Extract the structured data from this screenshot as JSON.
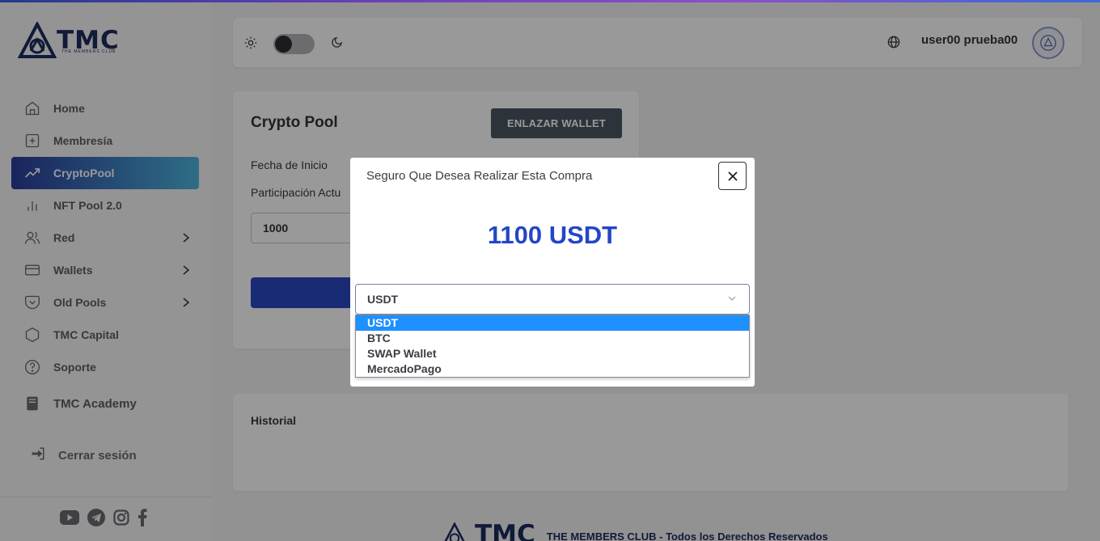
{
  "brand": {
    "name": "TMC",
    "tagline": "THE MEMBERS CLUB"
  },
  "sidebar": {
    "items": [
      {
        "label": "Home",
        "icon": "home-icon",
        "active": false,
        "has_chevron": false
      },
      {
        "label": "Membresía",
        "icon": "plus-square-icon",
        "active": false,
        "has_chevron": false
      },
      {
        "label": "CryptoPool",
        "icon": "trending-up-icon",
        "active": true,
        "has_chevron": false
      },
      {
        "label": "NFT Pool 2.0",
        "icon": "bar-chart-icon",
        "active": false,
        "has_chevron": false
      },
      {
        "label": "Red",
        "icon": "users-icon",
        "active": false,
        "has_chevron": true
      },
      {
        "label": "Wallets",
        "icon": "credit-card-icon",
        "active": false,
        "has_chevron": true
      },
      {
        "label": "Old Pools",
        "icon": "pocket-icon",
        "active": false,
        "has_chevron": true
      },
      {
        "label": "TMC Capital",
        "icon": "hexagon-icon",
        "active": false,
        "has_chevron": false
      },
      {
        "label": "Soporte",
        "icon": "help-circle-icon",
        "active": false,
        "has_chevron": false
      },
      {
        "label": "TMC Academy",
        "icon": "book-icon",
        "active": false,
        "has_chevron": false
      }
    ],
    "logout_label": "Cerrar sesión",
    "socials": [
      "youtube-icon",
      "telegram-icon",
      "instagram-icon",
      "facebook-icon"
    ]
  },
  "header": {
    "user_name": "user00 prueba00",
    "theme_dark": false
  },
  "card": {
    "title": "Crypto Pool",
    "link_wallet_label": "ENLAZAR WALLET",
    "start_date_label": "Fecha de Inicio",
    "participation_label": "Participación Actu",
    "amount_value": "1000"
  },
  "history": {
    "title": "Historial"
  },
  "footer": {
    "text": "THE MEMBERS CLUB - Todos los Derechos Reservados"
  },
  "modal": {
    "title": "Seguro Que Desea Realizar Esta Compra",
    "amount": "1100 USDT",
    "select_value": "USDT",
    "options": [
      "USDT",
      "BTC",
      "SWAP Wallet",
      "MercadoPago"
    ],
    "selected_option": "USDT"
  },
  "colors": {
    "accent": "#2446c6",
    "brand": "#1d2c5e",
    "active_start": "#2a3d9c",
    "active_end": "#4fb6e0",
    "option_highlight": "#1e90ff"
  }
}
